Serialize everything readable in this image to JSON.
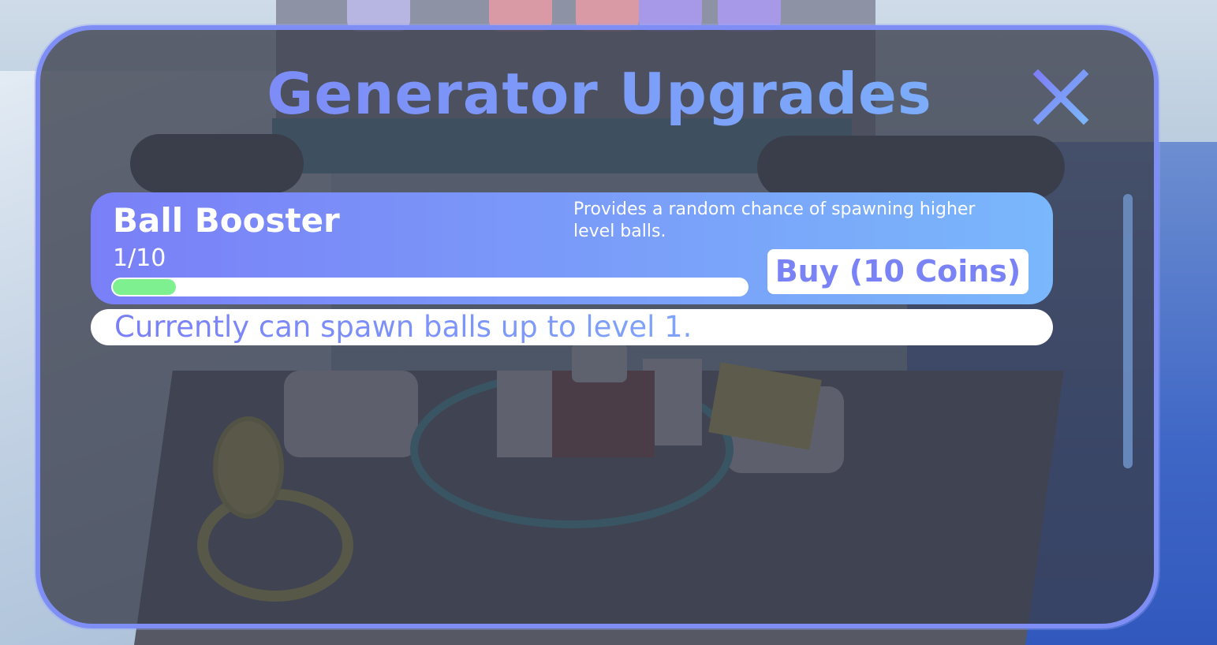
{
  "modal": {
    "title": "Generator Upgrades",
    "accent_color": "#7e8ef5",
    "gradient_start": "#7a7ff7",
    "gradient_end": "#7ab7fb",
    "close_icon": "close-icon"
  },
  "upgrades": [
    {
      "name": "Ball Booster",
      "level_text": "1/10",
      "progress": 0.1,
      "progress_color": "#7ef08f",
      "description": "Provides a random chance of spawning higher level balls.",
      "buy_label": "Buy (10 Coins)",
      "info": "Currently can spawn balls up to level 1."
    }
  ]
}
